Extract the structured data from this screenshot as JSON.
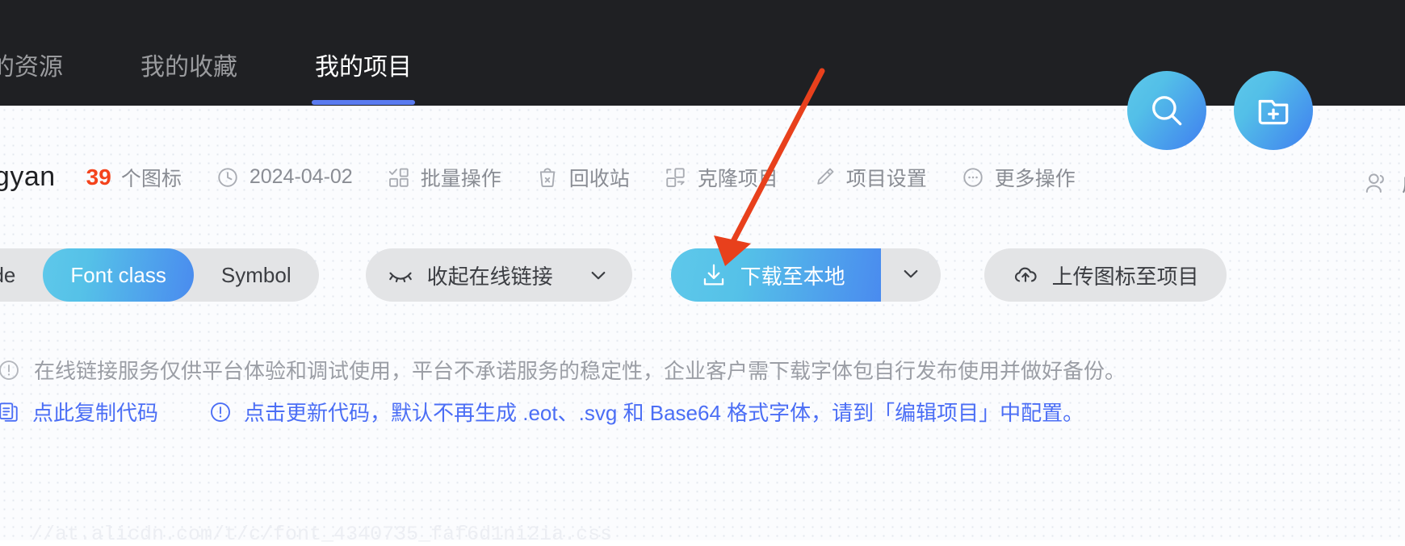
{
  "topnav": {
    "tabs": [
      {
        "label": "的资源",
        "active": false
      },
      {
        "label": "我的收藏",
        "active": false
      },
      {
        "label": "我的项目",
        "active": true
      }
    ],
    "active_underline_color": "#5a7bf0",
    "background_color": "#1f2023"
  },
  "fab": {
    "search": {
      "icon": "search-icon",
      "label": "搜索"
    },
    "new_project": {
      "icon": "new-project-icon",
      "label": "新建项目"
    },
    "gradient_from": "#5ec8ea",
    "gradient_to": "#3f7ef0"
  },
  "project": {
    "name": "lqingyan",
    "icon_count": "39",
    "icon_count_label": "个图标",
    "icon_count_color": "#f4431c",
    "date": "2024-04-02",
    "actions": [
      {
        "label": "批量操作",
        "icon": "batch-operation-icon"
      },
      {
        "label": "回收站",
        "icon": "recycle-bin-icon"
      },
      {
        "label": "克隆项目",
        "icon": "clone-project-icon"
      },
      {
        "label": "项目设置",
        "icon": "pencil-settings-icon"
      },
      {
        "label": "更多操作",
        "icon": "more-ellipsis-icon"
      }
    ],
    "members_label": "成员"
  },
  "actionbar": {
    "segmented": [
      {
        "label": "Unicode",
        "active": false
      },
      {
        "label": "Font class",
        "active": true
      },
      {
        "label": "Symbol",
        "active": false
      }
    ],
    "collapse_link": {
      "label": "收起在线链接",
      "icon": "eye-closed-icon"
    },
    "download": {
      "label": "下载至本地",
      "icon": "download-icon"
    },
    "upload": {
      "label": "上传图标至项目",
      "icon": "cloud-upload-icon"
    },
    "accent_color": "#4a8bef"
  },
  "notices": {
    "warning": "在线链接服务仅供平台体验和调试使用，平台不承诺服务的稳定性，企业客户需下载字体包自行发布使用并做好备份。",
    "copy_code": "点此复制代码",
    "update_note": "点击更新代码，默认不再生成 .eot、.svg 和 Base64 格式字体，请到「编辑项目」中配置。",
    "link_color": "#4b6ef5"
  },
  "css_url": "//at.alicdn.com/t/c/font_4340735_faf6d1ni2ia.css",
  "annotation": {
    "type": "arrow",
    "color": "#e8401c",
    "points_to": "下载至本地"
  }
}
